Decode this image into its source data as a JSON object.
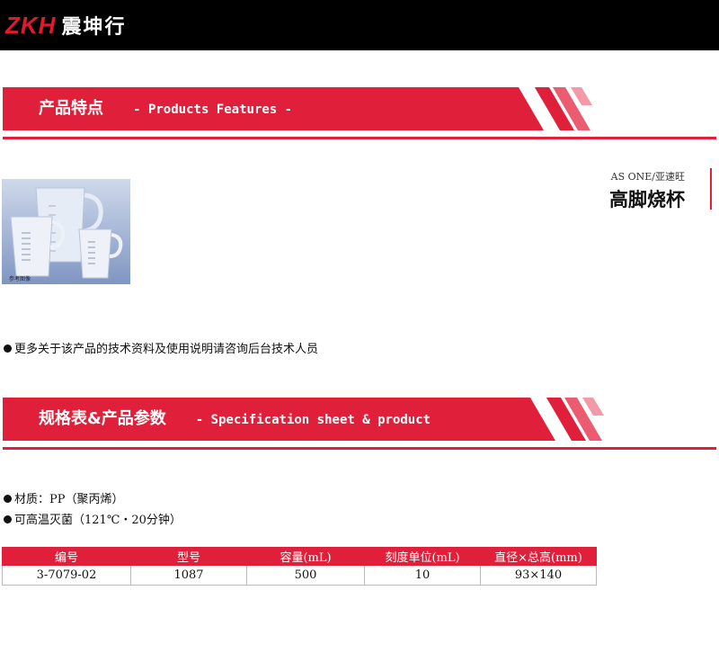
{
  "header": {
    "logo_mark": "ZKH",
    "logo_text": "震坤行"
  },
  "features_banner": {
    "title_zh": "产品特点",
    "title_en": "-  Products Features -"
  },
  "product": {
    "brand": "AS ONE/亚速旺",
    "name": "高脚烧杯",
    "image_caption": "参考图像",
    "note": "更多关于该产品的技术资料及使用说明请咨询后台技术人员"
  },
  "spec_banner": {
    "title_zh": "规格表&产品参数",
    "title_en": "-  Specification sheet & product"
  },
  "specs": {
    "material": "材质：PP（聚丙烯）",
    "sterilization": "可高温灭菌（121℃・20分钟）"
  },
  "table": {
    "headers": [
      "编号",
      "型号",
      "容量(mL)",
      "刻度单位(mL)",
      "直径×总高(mm)"
    ],
    "rows": [
      [
        "3-7079-02",
        "1087",
        "500",
        "10",
        "93×140"
      ]
    ]
  },
  "colors": {
    "accent": "#e0203a",
    "header_bg": "#000000"
  }
}
